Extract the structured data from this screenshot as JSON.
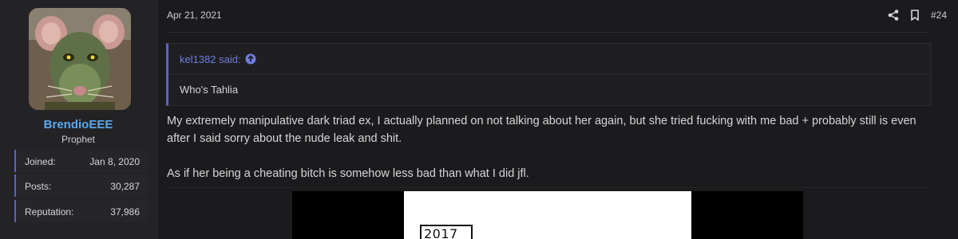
{
  "user": {
    "name": "BrendioEEE",
    "title": "Prophet",
    "stats": [
      {
        "label": "Joined:",
        "value": "Jan 8, 2020"
      },
      {
        "label": "Posts:",
        "value": "30,287"
      },
      {
        "label": "Reputation:",
        "value": "37,986"
      }
    ]
  },
  "post": {
    "date": "Apr 21, 2021",
    "number": "#24",
    "quote": {
      "author_line": "kel1382 said:",
      "text": "Who's Tahlia"
    },
    "paragraphs": [
      "My extremely manipulative dark triad ex, I actually planned on not talking about her again, but she tried fucking with me bad + probably still is even after I said sorry about the nude leak and shit.",
      "As if her being a cheating bitch is somehow less bad than what I did jfl."
    ],
    "image_text": "2017"
  },
  "colors": {
    "background": "#1b1b1d",
    "panel": "#232326",
    "accent": "#5a62c8",
    "username": "#5aa9f0",
    "quote_author": "#6f7de0"
  },
  "icons": {
    "share": "share-icon",
    "bookmark": "bookmark-icon",
    "jump": "arrow-up-circle-icon"
  }
}
